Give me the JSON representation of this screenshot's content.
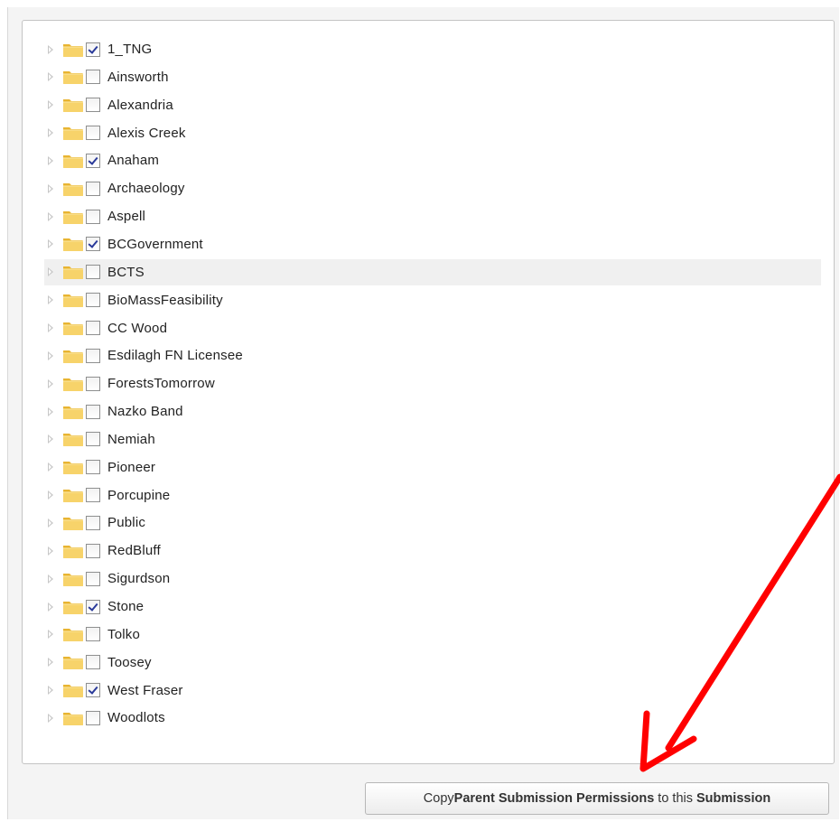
{
  "tree": {
    "items": [
      {
        "label": "1_TNG",
        "checked": true
      },
      {
        "label": "Ainsworth",
        "checked": false
      },
      {
        "label": "Alexandria",
        "checked": false
      },
      {
        "label": "Alexis Creek",
        "checked": false
      },
      {
        "label": "Anaham",
        "checked": true
      },
      {
        "label": "Archaeology",
        "checked": false
      },
      {
        "label": "Aspell",
        "checked": false
      },
      {
        "label": "BCGovernment",
        "checked": true
      },
      {
        "label": "BCTS",
        "checked": false,
        "hover": true
      },
      {
        "label": "BioMassFeasibility",
        "checked": false
      },
      {
        "label": "CC Wood",
        "checked": false
      },
      {
        "label": "Esdilagh FN Licensee",
        "checked": false
      },
      {
        "label": "ForestsTomorrow",
        "checked": false
      },
      {
        "label": "Nazko Band",
        "checked": false
      },
      {
        "label": "Nemiah",
        "checked": false
      },
      {
        "label": "Pioneer",
        "checked": false
      },
      {
        "label": "Porcupine",
        "checked": false
      },
      {
        "label": "Public",
        "checked": false
      },
      {
        "label": "RedBluff",
        "checked": false
      },
      {
        "label": "Sigurdson",
        "checked": false
      },
      {
        "label": "Stone",
        "checked": true
      },
      {
        "label": "Tolko",
        "checked": false
      },
      {
        "label": "Toosey",
        "checked": false
      },
      {
        "label": "West Fraser",
        "checked": true
      },
      {
        "label": "Woodlots",
        "checked": false
      }
    ]
  },
  "copy_button": {
    "part1": "Copy ",
    "part2": "Parent Submission Permissions",
    "part3": " to this ",
    "part4": "Submission"
  },
  "colors": {
    "annotation_arrow": "#ff0000",
    "folder_fill": "#f5c94a",
    "checkmark": "#2a3a9a"
  }
}
